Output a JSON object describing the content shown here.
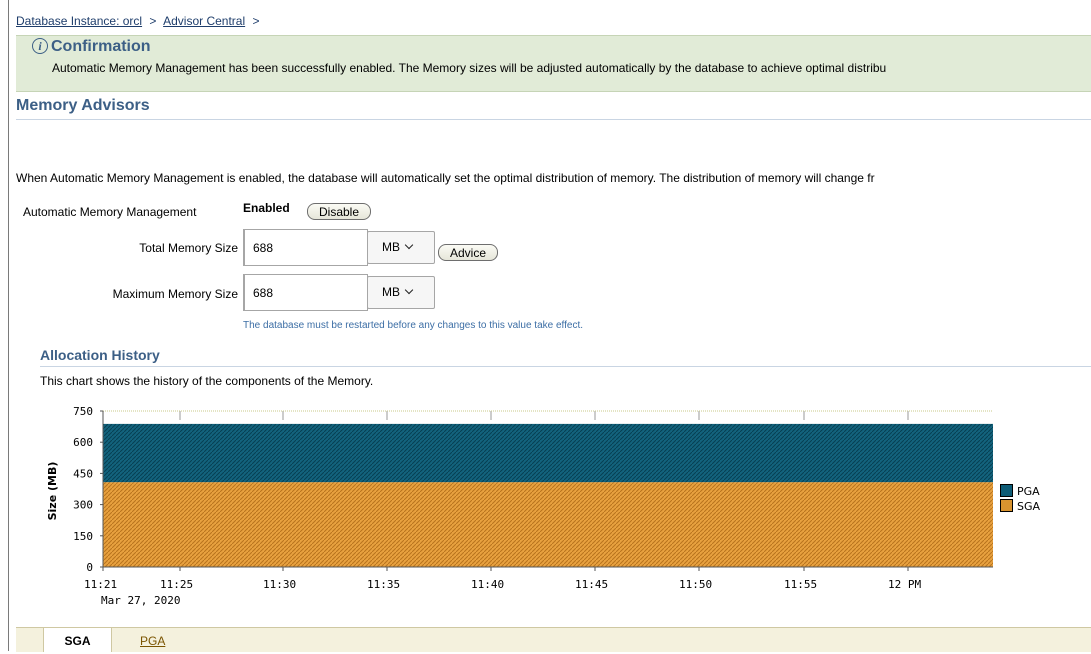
{
  "breadcrumb": {
    "items": [
      {
        "label": "Database Instance: orcl",
        "sep": ">"
      },
      {
        "label": "Advisor Central",
        "sep": ">"
      }
    ]
  },
  "confirmation": {
    "title": "Confirmation",
    "icon": "info-icon",
    "message": "Automatic Memory Management has been successfully enabled. The Memory sizes will be adjusted automatically by the database to achieve optimal distribu"
  },
  "page_title": "Memory Advisors",
  "intro_text": "When Automatic Memory Management is enabled, the database will automatically set the optimal distribution of memory. The distribution of memory will change fr",
  "amm": {
    "label": "Automatic Memory Management",
    "status": "Enabled",
    "disable_button": "Disable"
  },
  "total_memory": {
    "label": "Total Memory Size",
    "value": "688",
    "unit": "MB",
    "advice_button": "Advice"
  },
  "max_memory": {
    "label": "Maximum Memory Size",
    "value": "688",
    "unit": "MB",
    "hint": "The database must be restarted before any changes to this value take effect."
  },
  "allocation": {
    "title": "Allocation History",
    "description": "This chart shows the history of the components of the Memory."
  },
  "chart_data": {
    "type": "area",
    "ylabel": "Size (MB)",
    "ylim": [
      0,
      750
    ],
    "y_ticks": [
      "0",
      "150",
      "300",
      "450",
      "600",
      "750"
    ],
    "x_ticks": [
      "11:21",
      "11:25",
      "11:30",
      "11:35",
      "11:40",
      "11:45",
      "11:50",
      "11:55",
      "12 PM"
    ],
    "x_date": "Mar 27, 2020",
    "stacked": true,
    "series": [
      {
        "name": "SGA",
        "value": 408,
        "color": "#d8932f"
      },
      {
        "name": "PGA",
        "value": 280,
        "color": "#0d5c76"
      }
    ],
    "total": 688,
    "legend": "right"
  },
  "tabs": [
    {
      "label": "SGA",
      "selected": true
    },
    {
      "label": "PGA",
      "selected": false
    }
  ]
}
